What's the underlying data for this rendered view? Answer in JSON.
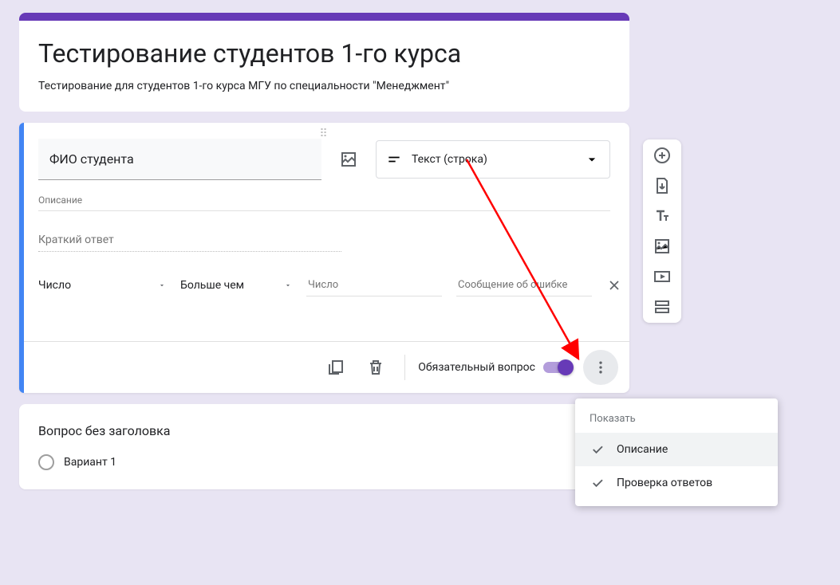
{
  "header": {
    "title": "Тестирование студентов 1-го курса",
    "description": "Тестирование для студентов 1-го курса МГУ по специальности \"Менеджмент\""
  },
  "question": {
    "title": "ФИО студента",
    "type_label": "Текст (строка)",
    "desc_placeholder": "Описание",
    "answer_placeholder": "Краткий ответ",
    "validation": {
      "rule": "Число",
      "operator": "Больше чем",
      "value_placeholder": "Число",
      "error_placeholder": "Сообщение об ошибке"
    },
    "required_label": "Обязательный вопрос"
  },
  "question2": {
    "title": "Вопрос без заголовка",
    "option1": "Вариант 1"
  },
  "popup": {
    "title": "Показать",
    "item1": "Описание",
    "item2": "Проверка ответов"
  }
}
